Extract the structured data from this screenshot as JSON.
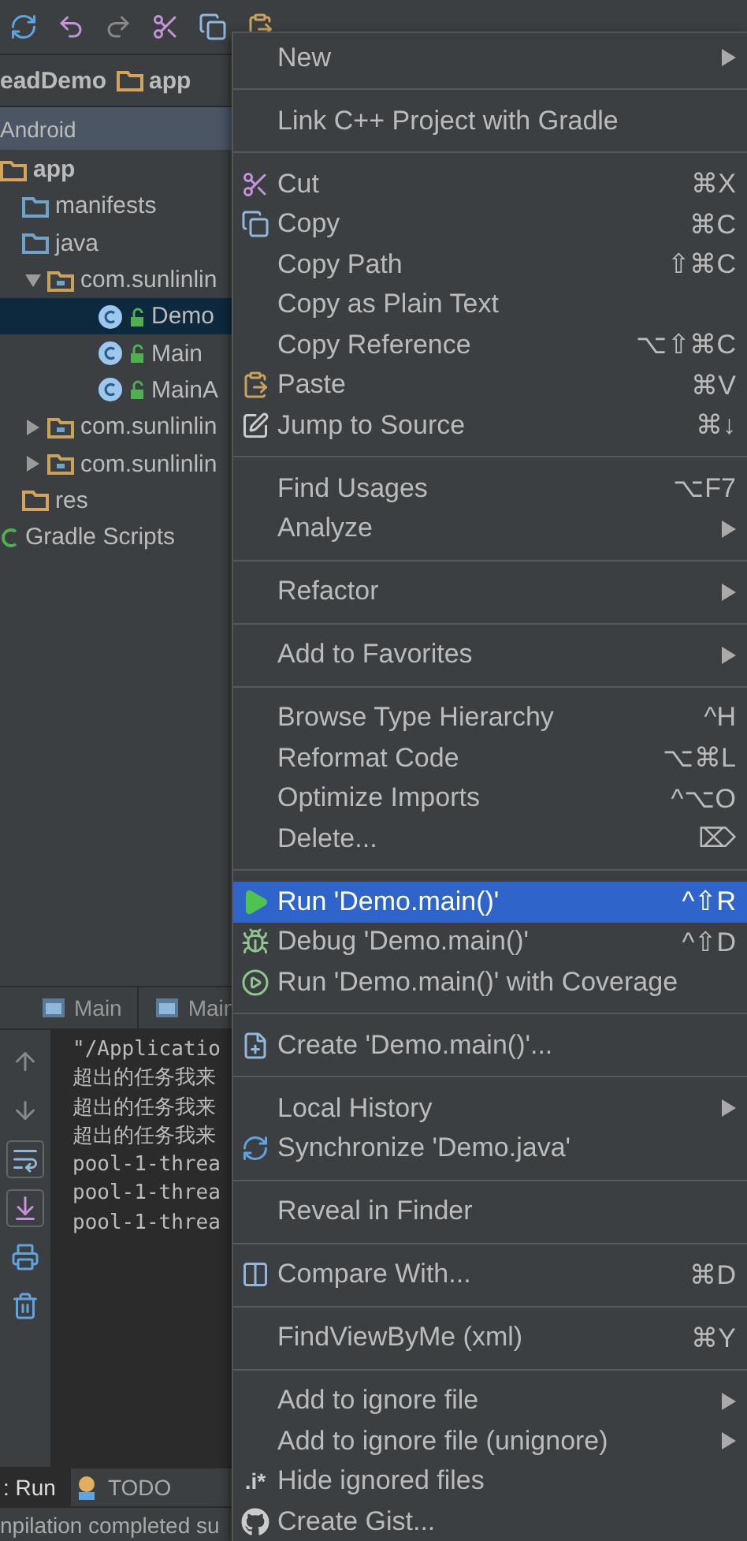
{
  "breadcrumb": [
    "eadDemo",
    "app"
  ],
  "project_view": {
    "title": "Android"
  },
  "tree": [
    {
      "label": "app",
      "kind": "module",
      "selected": false,
      "children": [
        {
          "label": "manifests",
          "kind": "folder",
          "selected": false
        },
        {
          "label": "java",
          "kind": "folder",
          "selected": false,
          "children": [
            {
              "label": "com.sunlinlin",
              "kind": "package",
              "selected": false,
              "expanded": true,
              "children": [
                {
                  "label": "Demo",
                  "kind": "class",
                  "selected": true
                },
                {
                  "label": "Main",
                  "kind": "class",
                  "selected": false
                },
                {
                  "label": "MainA",
                  "kind": "class",
                  "selected": false
                }
              ]
            },
            {
              "label": "com.sunlinlin",
              "kind": "package",
              "selected": false,
              "expanded": false
            },
            {
              "label": "com.sunlinlin",
              "kind": "package",
              "selected": false,
              "expanded": false
            }
          ]
        },
        {
          "label": "res",
          "kind": "res",
          "selected": false
        }
      ]
    },
    {
      "label": "Gradle Scripts",
      "kind": "gradle",
      "selected": false
    }
  ],
  "run_tabs": [
    "Main",
    "Main"
  ],
  "console": [
    "\"/Applicatio",
    "超出的任务我来",
    "超出的任务我来",
    "超出的任务我来",
    "pool-1-threa",
    "pool-1-threa",
    "pool-1-threa"
  ],
  "bottom_tabs": [
    {
      "label": ": Run",
      "selected": true
    },
    {
      "label": "TODO",
      "selected": false
    }
  ],
  "status": "npilation completed su",
  "context_menu": [
    {
      "kind": "item",
      "label": "New",
      "submenu": true,
      "selected": false
    },
    {
      "kind": "separator"
    },
    {
      "kind": "item",
      "label": "Link C++ Project with Gradle",
      "selected": false
    },
    {
      "kind": "separator"
    },
    {
      "kind": "item",
      "label": "Cut",
      "shortcut": "⌘X",
      "selected": false
    },
    {
      "kind": "item",
      "label": "Copy",
      "shortcut": "⌘C",
      "selected": false
    },
    {
      "kind": "item",
      "label": "Copy Path",
      "shortcut": "⇧⌘C",
      "selected": false
    },
    {
      "kind": "item",
      "label": "Copy as Plain Text",
      "selected": false
    },
    {
      "kind": "item",
      "label": "Copy Reference",
      "shortcut": "⌥⇧⌘C",
      "selected": false
    },
    {
      "kind": "item",
      "label": "Paste",
      "shortcut": "⌘V",
      "selected": false
    },
    {
      "kind": "item",
      "label": "Jump to Source",
      "shortcut": "⌘↓",
      "selected": false
    },
    {
      "kind": "separator"
    },
    {
      "kind": "item",
      "label": "Find Usages",
      "shortcut": "⌥F7",
      "selected": false
    },
    {
      "kind": "item",
      "label": "Analyze",
      "submenu": true,
      "selected": false
    },
    {
      "kind": "separator"
    },
    {
      "kind": "item",
      "label": "Refactor",
      "submenu": true,
      "selected": false
    },
    {
      "kind": "separator"
    },
    {
      "kind": "item",
      "label": "Add to Favorites",
      "submenu": true,
      "selected": false
    },
    {
      "kind": "separator"
    },
    {
      "kind": "item",
      "label": "Browse Type Hierarchy",
      "shortcut": "^H",
      "selected": false
    },
    {
      "kind": "item",
      "label": "Reformat Code",
      "shortcut": "⌥⌘L",
      "selected": false
    },
    {
      "kind": "item",
      "label": "Optimize Imports",
      "shortcut": "^⌥O",
      "selected": false
    },
    {
      "kind": "item",
      "label": "Delete...",
      "shortcut": "⌦",
      "selected": false
    },
    {
      "kind": "separator"
    },
    {
      "kind": "item",
      "label": "Run 'Demo.main()'",
      "shortcut": "^⇧R",
      "selected": true
    },
    {
      "kind": "item",
      "label": "Debug 'Demo.main()'",
      "shortcut": "^⇧D",
      "selected": false
    },
    {
      "kind": "item",
      "label": "Run 'Demo.main()' with Coverage",
      "selected": false
    },
    {
      "kind": "separator"
    },
    {
      "kind": "item",
      "label": "Create 'Demo.main()'...",
      "selected": false
    },
    {
      "kind": "separator"
    },
    {
      "kind": "item",
      "label": "Local History",
      "submenu": true,
      "selected": false
    },
    {
      "kind": "item",
      "label": "Synchronize 'Demo.java'",
      "selected": false
    },
    {
      "kind": "separator"
    },
    {
      "kind": "item",
      "label": "Reveal in Finder",
      "selected": false
    },
    {
      "kind": "separator"
    },
    {
      "kind": "item",
      "label": "Compare With...",
      "shortcut": "⌘D",
      "selected": false
    },
    {
      "kind": "separator"
    },
    {
      "kind": "item",
      "label": "FindViewByMe (xml)",
      "shortcut": "⌘Y",
      "selected": false
    },
    {
      "kind": "separator"
    },
    {
      "kind": "item",
      "label": "Add to ignore file",
      "submenu": true,
      "selected": false
    },
    {
      "kind": "item",
      "label": "Add to ignore file (unignore)",
      "submenu": true,
      "selected": false
    },
    {
      "kind": "item",
      "label": "Hide ignored files",
      "glyph": ".i*",
      "selected": false
    },
    {
      "kind": "item",
      "label": "Create Gist...",
      "selected": false
    }
  ]
}
